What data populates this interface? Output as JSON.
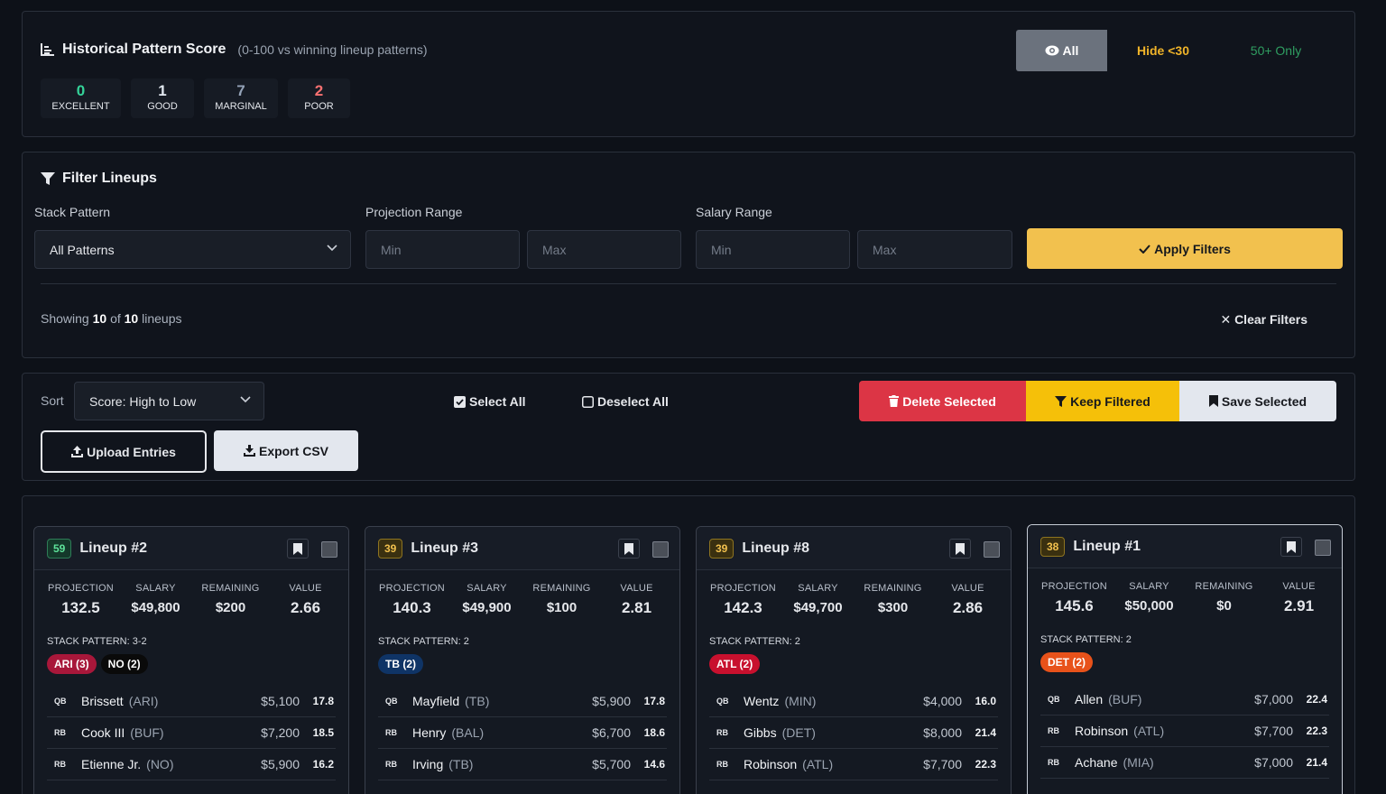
{
  "pattern_score": {
    "title": "Historical Pattern Score",
    "subtitle": "(0-100 vs winning lineup patterns)",
    "counts": [
      {
        "value": "0",
        "label": "EXCELLENT",
        "color": "#34d399"
      },
      {
        "value": "1",
        "label": "GOOD",
        "color": "#e2e8f0"
      },
      {
        "value": "7",
        "label": "MARGINAL",
        "color": "#94a3b8"
      },
      {
        "value": "2",
        "label": "POOR",
        "color": "#f87171"
      }
    ],
    "filters": {
      "all": "All",
      "hide": "Hide <30",
      "fifty": "50+ Only"
    }
  },
  "filter_lineups": {
    "title": "Filter Lineups",
    "stack_label": "Stack Pattern",
    "stack_value": "All Patterns",
    "projection_label": "Projection Range",
    "salary_label": "Salary Range",
    "min_placeholder": "Min",
    "max_placeholder": "Max",
    "apply_label": "Apply Filters",
    "showing_prefix": "Showing",
    "showing_count": "10",
    "showing_of": "of",
    "showing_total": "10",
    "showing_suffix": "lineups",
    "clear_label": "Clear Filters"
  },
  "actions": {
    "sort_label": "Sort",
    "sort_value": "Score: High to Low",
    "select_all": "Select All",
    "deselect_all": "Deselect All",
    "delete_selected": "Delete Selected",
    "keep_filtered": "Keep Filtered",
    "save_selected": "Save Selected",
    "upload_entries": "Upload Entries",
    "export_csv": "Export CSV"
  },
  "stat_labels": {
    "projection": "PROJECTION",
    "salary": "SALARY",
    "remaining": "REMAINING",
    "value": "VALUE"
  },
  "lineups": [
    {
      "score": "59",
      "name": "Lineup #2",
      "projection": "132.5",
      "salary": "$49,800",
      "remaining": "$200",
      "value": "2.66",
      "stack": "STACK PATTERN: 3-2",
      "chips": [
        {
          "text": "ARI (3)",
          "bg": "#a8173a"
        },
        {
          "text": "NO (2)",
          "bg": "#0a0a0a"
        }
      ],
      "players": [
        {
          "pos": "QB",
          "name": "Brissett",
          "team": "(ARI)",
          "salary": "$5,100",
          "pts": "17.8"
        },
        {
          "pos": "RB",
          "name": "Cook III",
          "team": "(BUF)",
          "salary": "$7,200",
          "pts": "18.5"
        },
        {
          "pos": "RB",
          "name": "Etienne Jr.",
          "team": "(NO)",
          "salary": "$5,900",
          "pts": "16.2"
        }
      ]
    },
    {
      "score": "39",
      "name": "Lineup #3",
      "projection": "140.3",
      "salary": "$49,900",
      "remaining": "$100",
      "value": "2.81",
      "stack": "STACK PATTERN: 2",
      "chips": [
        {
          "text": "TB (2)",
          "bg": "#0f3466"
        }
      ],
      "players": [
        {
          "pos": "QB",
          "name": "Mayfield",
          "team": "(TB)",
          "salary": "$5,900",
          "pts": "17.8"
        },
        {
          "pos": "RB",
          "name": "Henry",
          "team": "(BAL)",
          "salary": "$6,700",
          "pts": "18.6"
        },
        {
          "pos": "RB",
          "name": "Irving",
          "team": "(TB)",
          "salary": "$5,700",
          "pts": "14.6"
        }
      ]
    },
    {
      "score": "39",
      "name": "Lineup #8",
      "projection": "142.3",
      "salary": "$49,700",
      "remaining": "$300",
      "value": "2.86",
      "stack": "STACK PATTERN: 2",
      "chips": [
        {
          "text": "ATL (2)",
          "bg": "#c8102e"
        }
      ],
      "players": [
        {
          "pos": "QB",
          "name": "Wentz",
          "team": "(MIN)",
          "salary": "$4,000",
          "pts": "16.0"
        },
        {
          "pos": "RB",
          "name": "Gibbs",
          "team": "(DET)",
          "salary": "$8,000",
          "pts": "21.4"
        },
        {
          "pos": "RB",
          "name": "Robinson",
          "team": "(ATL)",
          "salary": "$7,700",
          "pts": "22.3"
        }
      ]
    },
    {
      "score": "38",
      "name": "Lineup #1",
      "projection": "145.6",
      "salary": "$50,000",
      "remaining": "$0",
      "value": "2.91",
      "stack": "STACK PATTERN: 2",
      "chips": [
        {
          "text": "DET (2)",
          "bg": "#e8521a"
        }
      ],
      "players": [
        {
          "pos": "QB",
          "name": "Allen",
          "team": "(BUF)",
          "salary": "$7,000",
          "pts": "22.4"
        },
        {
          "pos": "RB",
          "name": "Robinson",
          "team": "(ATL)",
          "salary": "$7,700",
          "pts": "22.3"
        },
        {
          "pos": "RB",
          "name": "Achane",
          "team": "(MIA)",
          "salary": "$7,000",
          "pts": "21.4"
        }
      ]
    }
  ]
}
